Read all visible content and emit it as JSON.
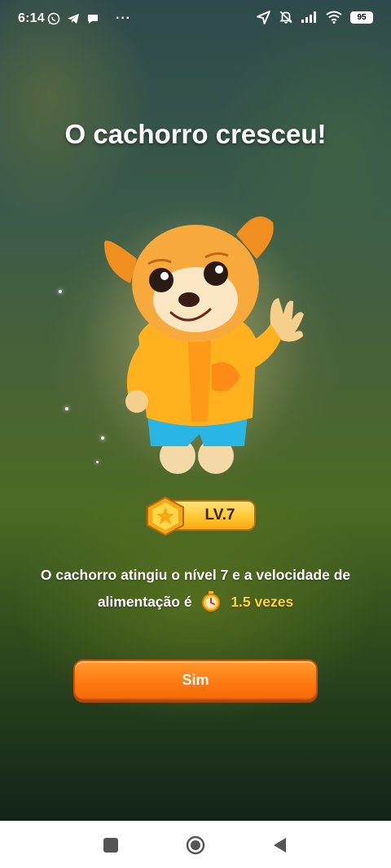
{
  "status_bar": {
    "time": "6:14",
    "left_icons": [
      "whatsapp-icon",
      "telegram-icon",
      "chat-icon"
    ],
    "more": "···",
    "right_icons": [
      "location-icon",
      "mute-icon",
      "signal-icon",
      "wifi-icon"
    ],
    "battery": "95"
  },
  "dialog": {
    "title": "O cachorro cresceu!",
    "level_label": "LV.7",
    "message_line1": "O cachorro atingiu o nível 7 e a velocidade de",
    "message_line2_prefix": "alimentação é",
    "speed_value": "1.5 vezes",
    "confirm_label": "Sim"
  },
  "colors": {
    "accent_orange": "#ff7a12",
    "gold": "#ffc52e",
    "speed_text": "#ffd23a"
  },
  "nav_bar": {
    "buttons": [
      "recents-square-icon",
      "home-circle-icon",
      "back-triangle-icon"
    ]
  }
}
